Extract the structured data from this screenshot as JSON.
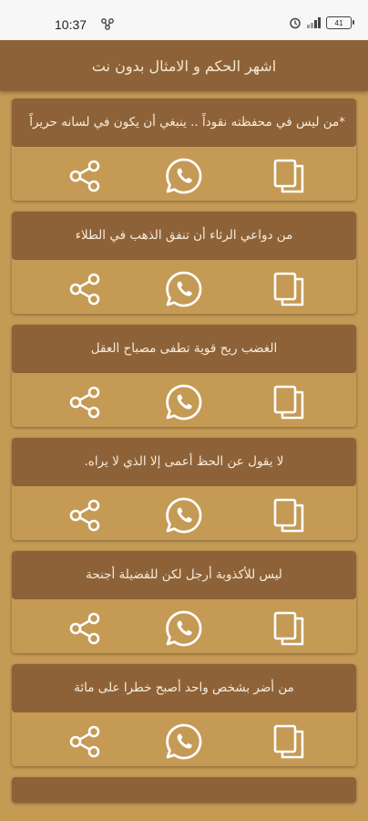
{
  "status_bar": {
    "time": "10:37",
    "battery": "41",
    "icons": [
      "link-icon",
      "alarm-icon",
      "signal-icon",
      "battery-icon"
    ]
  },
  "app_bar": {
    "title": "اشهر الحكم و الامثال بدون نت"
  },
  "colors": {
    "background": "#c49a55",
    "card_header": "#8e6238",
    "text": "#f6ecdc",
    "icon": "#ffffff"
  },
  "quotes": [
    {
      "text": "*من ليس في محفظته نقوداً .. ينبغي أن يكون في لسانه حريراً"
    },
    {
      "text": "من دواعي الرثاء أن تنفق الذهب في الطلاء"
    },
    {
      "text": "الغضب ريح قوية تطفى مصباح العقل"
    },
    {
      "text": "لا يقول عن الحظ أعمى إلا الذي لا يراه."
    },
    {
      "text": "ليس للأكذوبة أرجل لكن للفضيلة أجنحة"
    },
    {
      "text": "من أضر بشخص واحد أصبح خطرا على مائة"
    }
  ],
  "actions": {
    "share_icon": "share-icon",
    "whatsapp_icon": "whatsapp-icon",
    "copy_icon": "copy-icon"
  }
}
